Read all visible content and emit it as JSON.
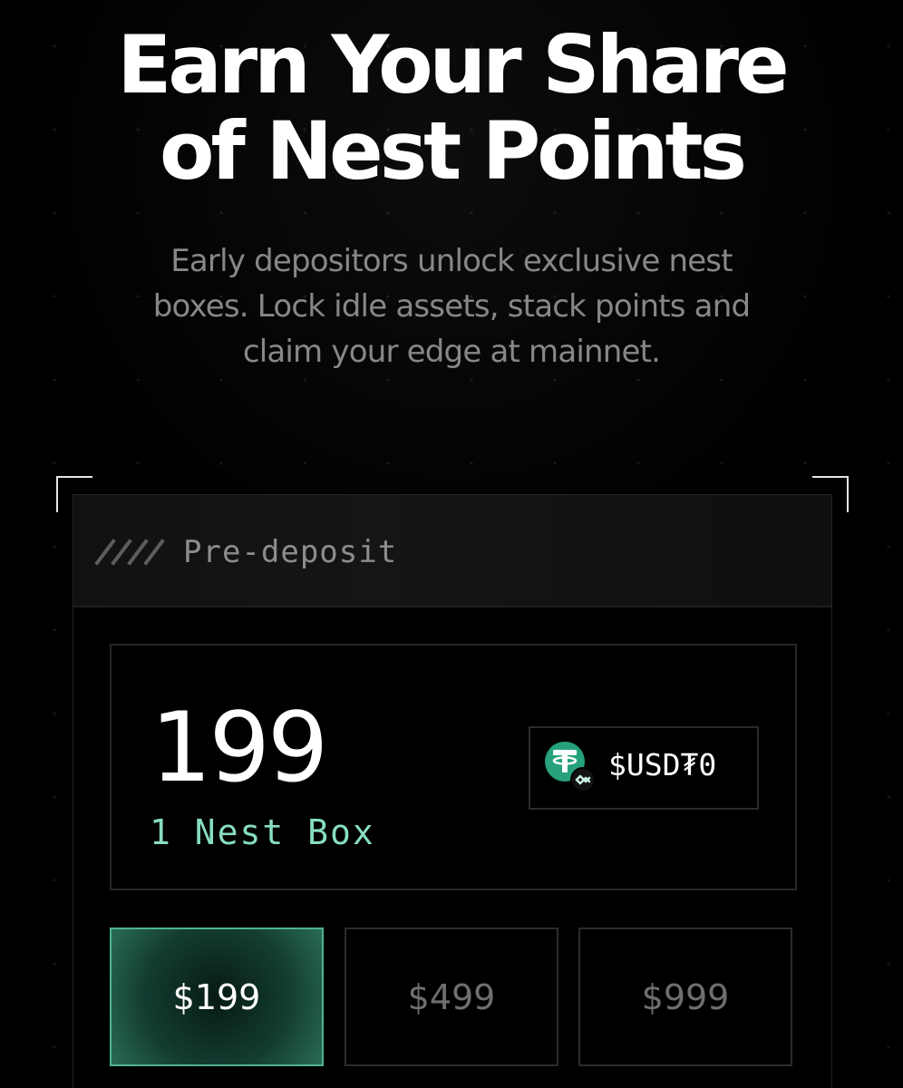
{
  "hero": {
    "title_lines": [
      "Earn Your Share",
      "of Nest Points"
    ],
    "subtitle_lines": [
      "Early depositors unlock exclusive nest",
      "boxes. Lock idle assets, stack points and",
      "claim your edge at mainnet."
    ]
  },
  "panel": {
    "header_label": "Pre-deposit",
    "amount": "199",
    "amount_subtext": "1 Nest Box",
    "token_label": "$USD₮0",
    "options": [
      "$199",
      "$499",
      "$999"
    ]
  },
  "colors": {
    "background": "#000000",
    "primary_text": "#ffffff",
    "muted_text": "#878787",
    "accent_text": "#87ddbf",
    "token_green": "#26a17b",
    "selected_border": "#4fb28f"
  },
  "icons": {
    "slashes": "slashes-icon",
    "token": "tether-token-icon"
  }
}
